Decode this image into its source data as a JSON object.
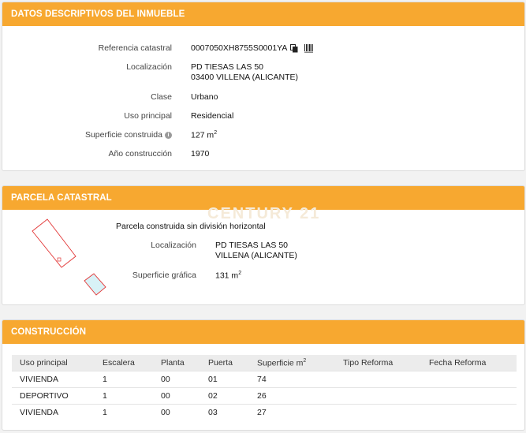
{
  "inmueble": {
    "title": "DATOS DESCRIPTIVOS DEL INMUEBLE",
    "ref_label": "Referencia catastral",
    "ref_value": "0007050XH8755S0001YA",
    "loc_label": "Localización",
    "loc_line1": "PD TIESAS LAS 50",
    "loc_line2": "03400 VILLENA (ALICANTE)",
    "clase_label": "Clase",
    "clase_value": "Urbano",
    "uso_label": "Uso principal",
    "uso_value": "Residencial",
    "sup_label": "Superficie construida",
    "sup_value": "127 m",
    "sup_exp": "2",
    "anio_label": "Año construcción",
    "anio_value": "1970"
  },
  "parcela": {
    "title": "PARCELA CATASTRAL",
    "watermark": "CENTURY 21",
    "desc": "Parcela construida sin división horizontal",
    "loc_label": "Localización",
    "loc_line1": "PD TIESAS LAS 50",
    "loc_line2": "VILLENA (ALICANTE)",
    "sup_label": "Superficie gráfica",
    "sup_value": "131 m",
    "sup_exp": "2"
  },
  "construccion": {
    "title": "CONSTRUCCIÓN",
    "headers": [
      "Uso principal",
      "Escalera",
      "Planta",
      "Puerta",
      "Superficie m",
      "Tipo Reforma",
      "Fecha Reforma"
    ],
    "sup_exp": "2",
    "rows": [
      [
        "VIVIENDA",
        "1",
        "00",
        "01",
        "74",
        "",
        ""
      ],
      [
        "DEPORTIVO",
        "1",
        "00",
        "02",
        "26",
        "",
        ""
      ],
      [
        "VIVIENDA",
        "1",
        "00",
        "03",
        "27",
        "",
        ""
      ]
    ]
  }
}
